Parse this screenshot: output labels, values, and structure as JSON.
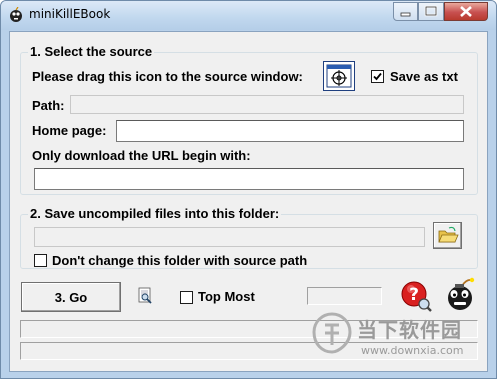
{
  "window": {
    "title": "miniKillEBook"
  },
  "source_group": {
    "title": "1. Select the source",
    "drag_label": "Please drag this icon to the source window:",
    "save_as_txt_label": "Save as txt",
    "save_as_txt_checked": true,
    "path_label": "Path:",
    "path_value": "",
    "home_page_label": "Home page:",
    "home_page_value": "",
    "url_prefix_label": "Only download the URL begin with:",
    "url_prefix_value": ""
  },
  "folder_group": {
    "title": "2. Save uncompiled files into this folder:",
    "folder_value": "",
    "dont_change_label": "Don't change this folder with source path",
    "dont_change_checked": false
  },
  "actions": {
    "go_label": "3. Go",
    "top_most_label": "Top Most",
    "top_most_checked": false
  },
  "watermark": {
    "brand": "当下软件园",
    "url": "www.downxia.com"
  },
  "icons": {
    "app": "bomb-icon",
    "target": "crosshair-target-icon",
    "folder": "open-folder-icon",
    "find": "magnifier-page-icon",
    "help": "help-question-icon",
    "about": "bomb-icon"
  }
}
